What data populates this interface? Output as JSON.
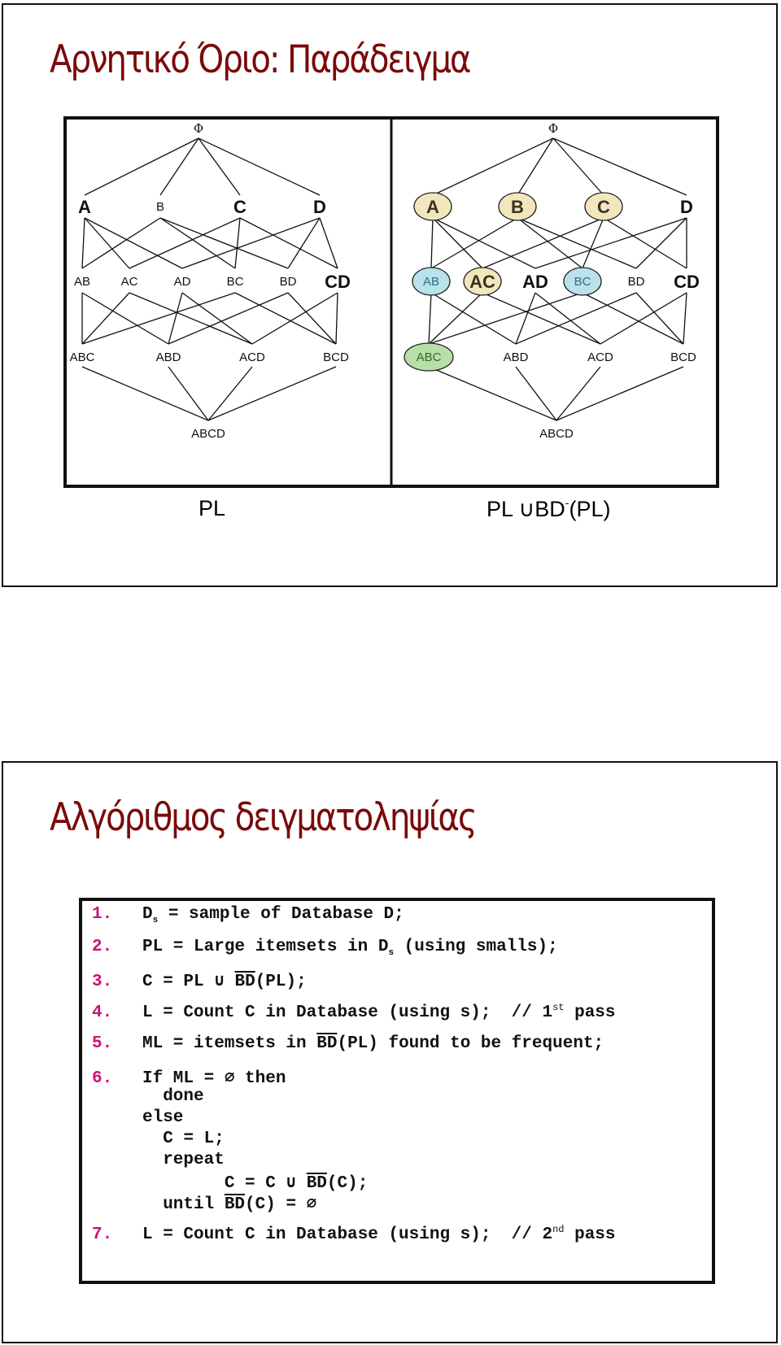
{
  "slides": [
    {
      "title": "Αρνητικό Όριο: Παράδειγμα",
      "diagram": {
        "left_panel": {
          "root": "Φ",
          "level1": [
            "A",
            "B",
            "C",
            "D"
          ],
          "level2": [
            "AB",
            "AC",
            "AD",
            "BC",
            "BD",
            "CD"
          ],
          "level3": [
            "ABC",
            "ABD",
            "ACD",
            "BCD"
          ],
          "level4": [
            "ABCD"
          ],
          "bold_nodes": [
            "A",
            "C",
            "D",
            "CD"
          ]
        },
        "right_panel": {
          "root": "Φ",
          "level1": [
            "A",
            "B",
            "C",
            "D"
          ],
          "level2": [
            "AB",
            "AC",
            "AD",
            "BC",
            "BD",
            "CD"
          ],
          "level3": [
            "ABC",
            "ABD",
            "ACD",
            "BCD"
          ],
          "level4": [
            "ABCD"
          ],
          "bold_nodes": [
            "A",
            "B",
            "C",
            "D",
            "AC",
            "AD",
            "CD"
          ],
          "highlighted": {
            "A": "#f2e6bd",
            "B": "#f2e6bd",
            "C": "#f2e6bd",
            "AC": "#f2e6bd",
            "AB": "#b9e2ea",
            "BC": "#b9e2ea",
            "ABC": "#b8dfa8"
          }
        },
        "edges": [
          [
            "Φ",
            "A"
          ],
          [
            "Φ",
            "B"
          ],
          [
            "Φ",
            "C"
          ],
          [
            "Φ",
            "D"
          ],
          [
            "A",
            "AB"
          ],
          [
            "A",
            "AC"
          ],
          [
            "A",
            "AD"
          ],
          [
            "B",
            "AB"
          ],
          [
            "B",
            "BC"
          ],
          [
            "B",
            "BD"
          ],
          [
            "C",
            "AC"
          ],
          [
            "C",
            "BC"
          ],
          [
            "C",
            "CD"
          ],
          [
            "D",
            "AD"
          ],
          [
            "D",
            "BD"
          ],
          [
            "D",
            "CD"
          ],
          [
            "AB",
            "ABC"
          ],
          [
            "AB",
            "ABD"
          ],
          [
            "AC",
            "ABC"
          ],
          [
            "AC",
            "ACD"
          ],
          [
            "AD",
            "ABD"
          ],
          [
            "AD",
            "ACD"
          ],
          [
            "BC",
            "ABC"
          ],
          [
            "BC",
            "BCD"
          ],
          [
            "BD",
            "ABD"
          ],
          [
            "BD",
            "BCD"
          ],
          [
            "CD",
            "ACD"
          ],
          [
            "CD",
            "BCD"
          ],
          [
            "ABC",
            "ABCD"
          ],
          [
            "ABD",
            "ABCD"
          ],
          [
            "ACD",
            "ABCD"
          ],
          [
            "BCD",
            "ABCD"
          ]
        ]
      },
      "captions": {
        "left": "PL",
        "right_prefix": "PL ∪BD",
        "right_sup": "-",
        "right_suffix": "(PL)"
      }
    },
    {
      "title": "Αλγόριθμος δειγματοληψίας",
      "code": [
        {
          "num": "1.",
          "parts": [
            [
              "t",
              "D"
            ],
            [
              "sub",
              "s"
            ],
            [
              "t",
              " = sample of Database D;"
            ]
          ]
        },
        {
          "num": "2.",
          "parts": [
            [
              "t",
              "PL = Large itemsets in D"
            ],
            [
              "sub",
              "s"
            ],
            [
              "t",
              " (using smalls);"
            ]
          ]
        },
        {
          "num": "3.",
          "parts": [
            [
              "t",
              "C = PL ∪ "
            ],
            [
              "ovl",
              "BD"
            ],
            [
              "t",
              "(PL);"
            ]
          ]
        },
        {
          "num": "4.",
          "parts": [
            [
              "t",
              "L = Count C in Database (using s);  // 1"
            ],
            [
              "sup",
              "st"
            ],
            [
              "t",
              " pass"
            ]
          ]
        },
        {
          "num": "5.",
          "parts": [
            [
              "t",
              "ML = itemsets in "
            ],
            [
              "ovl",
              "BD"
            ],
            [
              "t",
              "(PL) found to be frequent;"
            ]
          ]
        },
        {
          "num": "6.",
          "parts": [
            [
              "t",
              "If ML = ∅ then"
            ]
          ]
        },
        {
          "num": "",
          "parts": [
            [
              "t",
              "  done"
            ]
          ]
        },
        {
          "num": "",
          "parts": [
            [
              "t",
              "else"
            ]
          ]
        },
        {
          "num": "",
          "parts": [
            [
              "t",
              "  C = L;"
            ]
          ]
        },
        {
          "num": "",
          "parts": [
            [
              "t",
              "  repeat"
            ]
          ]
        },
        {
          "num": "",
          "parts": [
            [
              "t",
              "        C = C ∪ "
            ],
            [
              "ovl",
              "BD"
            ],
            [
              "t",
              "(C);"
            ]
          ]
        },
        {
          "num": "",
          "parts": [
            [
              "t",
              "  until "
            ],
            [
              "ovl",
              "BD"
            ],
            [
              "t",
              "(C) = ∅"
            ]
          ]
        },
        {
          "num": "7.",
          "parts": [
            [
              "t",
              "L = Count C in Database (using s);  // 2"
            ],
            [
              "sup",
              "nd"
            ],
            [
              "t",
              " pass"
            ]
          ]
        }
      ]
    }
  ],
  "colors": {
    "title": "#7a0a0a",
    "line_number": "#cc1177",
    "highlight_yellow": "#f2e6bd",
    "highlight_blue": "#b9e2ea",
    "highlight_green": "#b8dfa8"
  }
}
